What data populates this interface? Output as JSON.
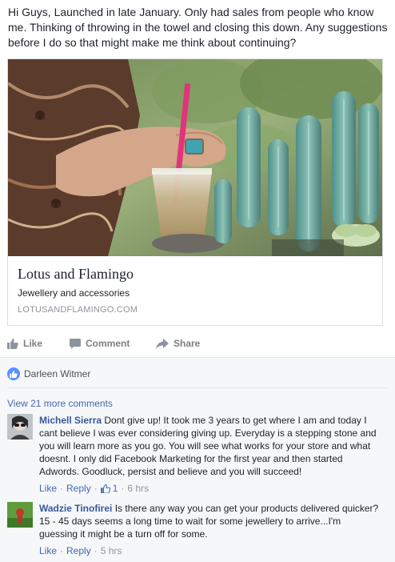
{
  "post": {
    "text": "Hi Guys, Launched in late January. Only had sales from people who know me. Thinking of throwing in the towel and closing this down. Any suggestions before I do so that might make me think about continuing?"
  },
  "link_card": {
    "title": "Lotus and Flamingo",
    "description": "Jewellery and accessories",
    "domain": "LOTUSANDFLAMINGO.COM"
  },
  "actions": {
    "like": "Like",
    "comment": "Comment",
    "share": "Share"
  },
  "reactions": {
    "names": "Darleen Witmer"
  },
  "comments": {
    "view_more": "View 21 more comments",
    "items": [
      {
        "author": "Michell Sierra",
        "text": "Dont give up! It took me 3 years to get where I am and today I cant believe I was ever considering giving up. Everyday is a stepping stone and you will learn more as you go. You will see what works for your store and what doesnt. I only did Facebook Marketing for the first year and then started Adwords. Goodluck, persist and believe and you will succeed!",
        "like": "Like",
        "reply": "Reply",
        "like_count": "1",
        "time": "6 hrs"
      },
      {
        "author": "Wadzie Tinofirei",
        "text": "Is there any way you can get your products delivered quicker? 15 - 45 days seems a long time to wait for some jewellery to arrive...I'm guessing it might be a turn off for some.",
        "like": "Like",
        "reply": "Reply",
        "time": "5 hrs"
      }
    ]
  },
  "colors": {
    "link": "#4267b2",
    "author": "#365899",
    "muted": "#90949c",
    "like_badge": "#5890ff"
  }
}
